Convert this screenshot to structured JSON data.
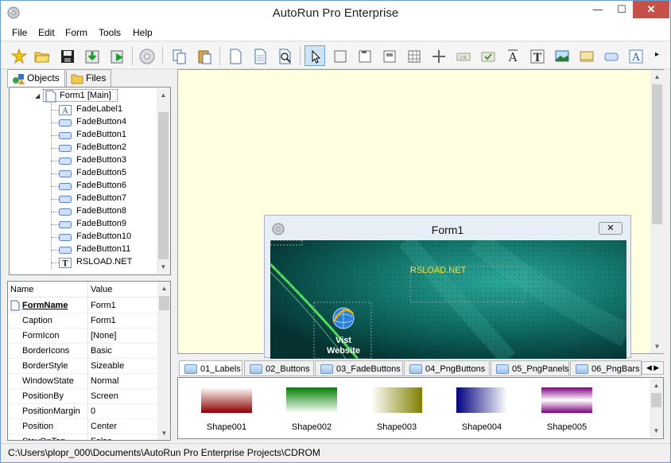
{
  "window": {
    "title": "AutoRun Pro Enterprise",
    "minimize": "—",
    "maximize": "☐",
    "close": "✕"
  },
  "menu": [
    "File",
    "Edit",
    "Form",
    "Tools",
    "Help"
  ],
  "left_tabs": [
    {
      "label": "Objects",
      "active": true
    },
    {
      "label": "Files",
      "active": false
    }
  ],
  "tree": {
    "root": "Form1 [Main]",
    "items": [
      {
        "label": "FadeLabel1",
        "icon": "label-a-icon"
      },
      {
        "label": "FadeButton4",
        "icon": "button-icon"
      },
      {
        "label": "FadeButton1",
        "icon": "button-icon"
      },
      {
        "label": "FadeButton2",
        "icon": "button-icon"
      },
      {
        "label": "FadeButton3",
        "icon": "button-icon"
      },
      {
        "label": "FadeButton5",
        "icon": "button-icon"
      },
      {
        "label": "FadeButton6",
        "icon": "button-icon"
      },
      {
        "label": "FadeButton7",
        "icon": "button-icon"
      },
      {
        "label": "FadeButton8",
        "icon": "button-icon"
      },
      {
        "label": "FadeButton9",
        "icon": "button-icon"
      },
      {
        "label": "FadeButton10",
        "icon": "button-icon"
      },
      {
        "label": "FadeButton11",
        "icon": "button-icon"
      },
      {
        "label": "RSLOAD.NET",
        "icon": "text-t-icon"
      }
    ]
  },
  "properties": {
    "header_name": "Name",
    "header_value": "Value",
    "rows": [
      {
        "name": "FormName",
        "value": "Form1"
      },
      {
        "name": "Caption",
        "value": "Form1"
      },
      {
        "name": "FormIcon",
        "value": "[None]"
      },
      {
        "name": "BorderIcons",
        "value": "Basic"
      },
      {
        "name": "BorderStyle",
        "value": "Sizeable"
      },
      {
        "name": "WindowState",
        "value": "Normal"
      },
      {
        "name": "PositionBy",
        "value": "Screen"
      },
      {
        "name": "PositionMargin",
        "value": "0"
      },
      {
        "name": "Position",
        "value": "Center"
      },
      {
        "name": "StayOnTop",
        "value": "False"
      }
    ]
  },
  "form_preview": {
    "title": "Form1",
    "close": "✕",
    "label_text": "RSLOAD.NET",
    "button_line1": "Vist",
    "button_line2": "Website",
    "label_color": "#e6e64a"
  },
  "bottom_tabs": [
    "01_Labels",
    "02_Buttons",
    "03_FadeButtons",
    "04_PngButtons",
    "05_PngPanels",
    "06_PngBars"
  ],
  "shapes": [
    {
      "label": "Shape001",
      "from": "#8b0000",
      "to": "#ffffff"
    },
    {
      "label": "Shape002",
      "from": "#008000",
      "to": "#ffffff"
    },
    {
      "label": "Shape003",
      "from": "#ffffff",
      "to": "#808000"
    },
    {
      "label": "Shape004",
      "from": "#000080",
      "to": "#ffffff"
    },
    {
      "label": "Shape005",
      "from": "#800080",
      "to": "#ffffff"
    }
  ],
  "status": "C:\\Users\\plopr_000\\Documents\\AutoRun Pro Enterprise Projects\\CDROM"
}
